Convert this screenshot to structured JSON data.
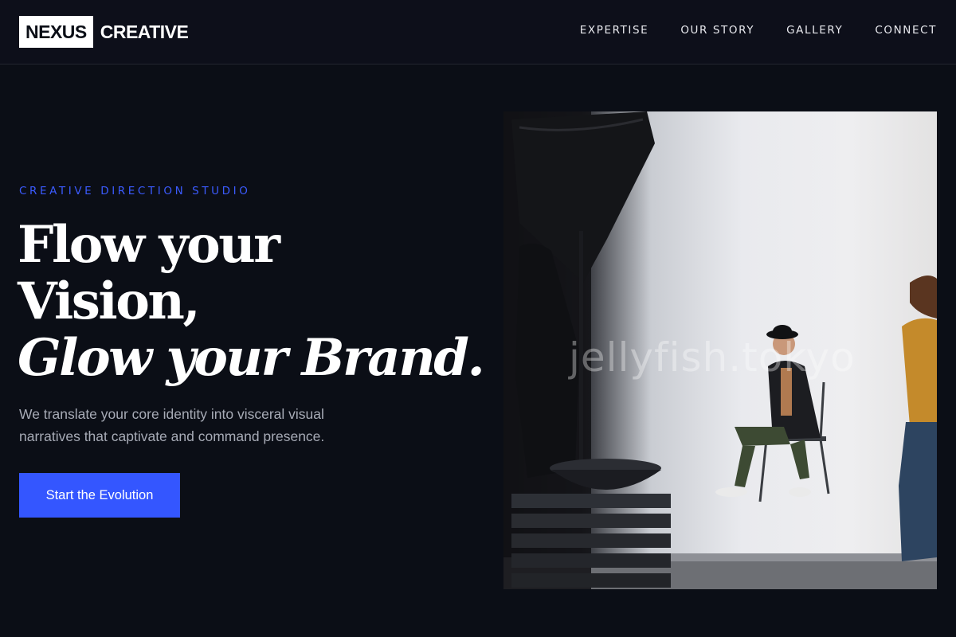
{
  "brand": {
    "logo_box": "NEXUS",
    "logo_word": "CREATIVE"
  },
  "nav": {
    "items": [
      "EXPERTISE",
      "OUR STORY",
      "GALLERY",
      "CONNECT"
    ]
  },
  "hero": {
    "eyebrow": "CREATIVE DIRECTION STUDIO",
    "headline_line1": "Flow your",
    "headline_line2": "Vision,",
    "headline_line3": "Glow your Brand.",
    "description_line1": "We translate your core identity into visceral visual",
    "description_line2": "narratives that captivate and command presence.",
    "cta_label": "Start the Evolution"
  },
  "photo": {
    "watermark": "jellyfish.tokyo"
  },
  "colors": {
    "accent": "#3456ff",
    "background": "#0b0e16",
    "header": "#0d0f1a"
  }
}
